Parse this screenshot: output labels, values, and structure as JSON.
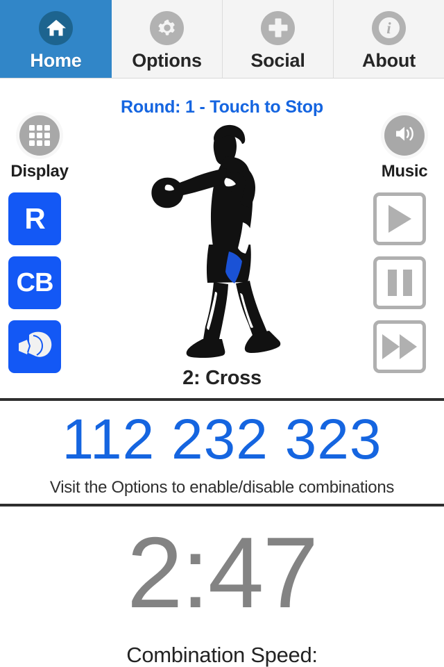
{
  "tabs": [
    {
      "label": "Home",
      "icon": "home-icon",
      "active": true
    },
    {
      "label": "Options",
      "icon": "gear-icon",
      "active": false
    },
    {
      "label": "Social",
      "icon": "plus-icon",
      "active": false
    },
    {
      "label": "About",
      "icon": "info-icon",
      "active": false
    }
  ],
  "status": {
    "round_line": "Round: 1 - Touch to Stop"
  },
  "left_rail": {
    "head_label": "Display",
    "head_icon": "grid-icon",
    "buttons": [
      {
        "label": "R",
        "name": "rounds-button"
      },
      {
        "label": "CB",
        "name": "combo-button"
      },
      {
        "label": "",
        "name": "glove-button",
        "icon": "boxing-glove-icon"
      }
    ]
  },
  "right_rail": {
    "head_label": "Music",
    "head_icon": "speaker-icon",
    "buttons": [
      {
        "icon": "play-icon",
        "name": "music-play-button"
      },
      {
        "icon": "pause-icon",
        "name": "music-pause-button"
      },
      {
        "icon": "next-icon",
        "name": "music-next-button"
      }
    ]
  },
  "figure": {
    "move_label": "2: Cross",
    "alt": "boxer-throwing-cross-silhouette"
  },
  "combination": {
    "value": "112 232 323",
    "hint": "Visit the Options to enable/disable combinations"
  },
  "timer": {
    "value": "2:47",
    "speed_label": "Combination Speed:"
  },
  "colors": {
    "accent_blue": "#3186c8",
    "link_blue": "#1565e0",
    "button_blue": "#1358f5",
    "gray": "#b0b0b0",
    "timer_gray": "#838383",
    "tab_bg": "#f4f4f4"
  }
}
